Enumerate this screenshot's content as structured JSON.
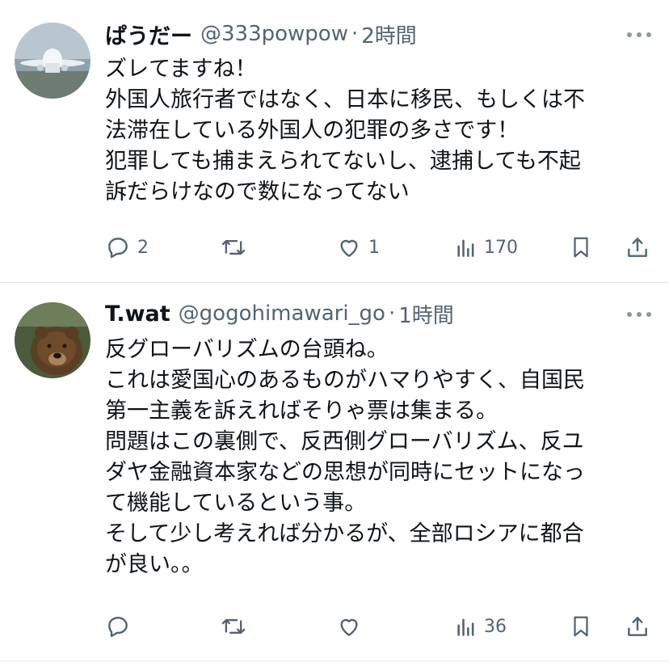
{
  "tweets": [
    {
      "name": "ぱうだー",
      "handle": "@333powpow",
      "separator": "·",
      "time": "2時間",
      "lines": [
        "ズレてますね！",
        "外国人旅行者ではなく、日本に移民、もしくは不",
        "法滞在している外国人の犯罪の多さです！",
        "犯罪しても捕まえられてないし、逮捕しても不起",
        "訴だらけなので数になってない"
      ],
      "replies": "2",
      "retweets": "",
      "likes": "1",
      "views": "170"
    },
    {
      "name": "T.wat",
      "handle": "@gogohimawari_go",
      "separator": "·",
      "time": "1時間",
      "lines": [
        "反グローバリズムの台頭ね。",
        "これは愛国心のあるものがハマりやすく、自国民",
        "第一主義を訴えればそりゃ票は集まる。",
        "問題はこの裏側で、反西側グローバリズム、反ユ",
        "ダヤ金融資本家などの思想が同時にセットになっ",
        "て機能しているという事。",
        "そして少し考えれば分かるが、全部ロシアに都合",
        "が良い。。"
      ],
      "replies": "",
      "retweets": "",
      "likes": "",
      "views": "36"
    }
  ],
  "colors": {
    "text": "#0f1419",
    "secondary": "#536471",
    "divider": "#e1e8ed"
  },
  "icons": [
    "more-icon",
    "reply-icon",
    "retweet-icon",
    "like-icon",
    "views-icon",
    "bookmark-icon",
    "share-icon"
  ]
}
